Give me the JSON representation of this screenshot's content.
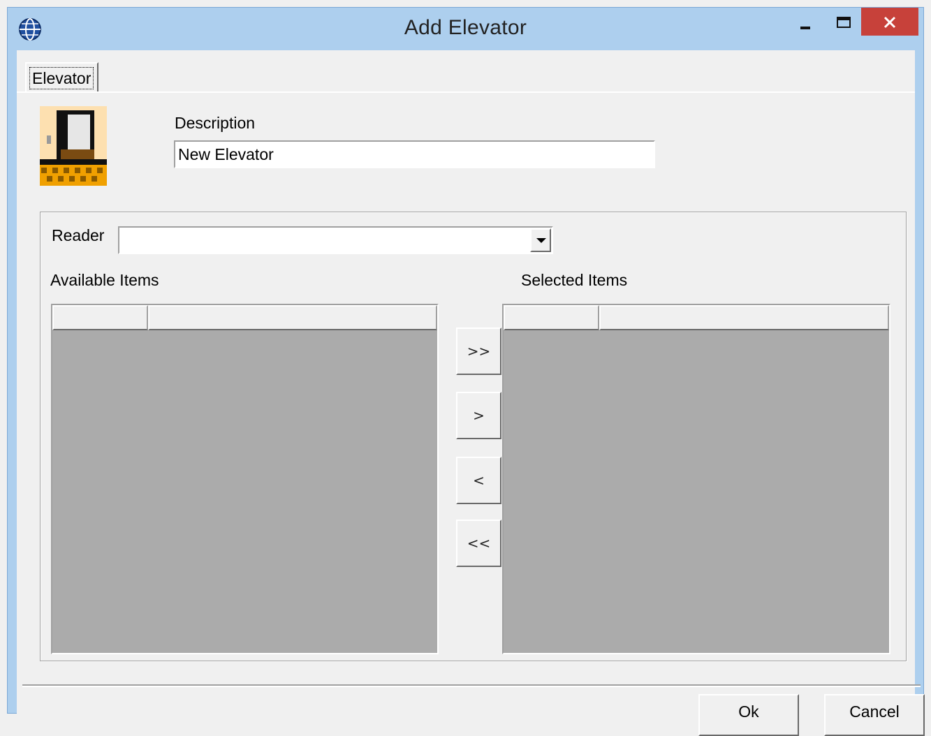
{
  "window": {
    "title": "Add Elevator",
    "icon": "globe-icon",
    "controls": [
      "minimize-icon",
      "maximize-icon",
      "close-icon"
    ],
    "close_color": "#c7413a",
    "titlebar_color": "#adcfee"
  },
  "tabs": [
    {
      "label": "Elevator",
      "active": true
    }
  ],
  "form": {
    "elevator_icon": "elevator-icon",
    "description_label": "Description",
    "description_value": "New Elevator",
    "reader_label": "Reader",
    "reader_value": "",
    "available_label": "Available Items",
    "selected_label": "Selected Items"
  },
  "move_buttons": {
    "add_all": ">>",
    "add_one": ">",
    "remove_one": "<",
    "remove_all": "<<"
  },
  "footer": {
    "ok_label": "Ok",
    "cancel_label": "Cancel"
  }
}
